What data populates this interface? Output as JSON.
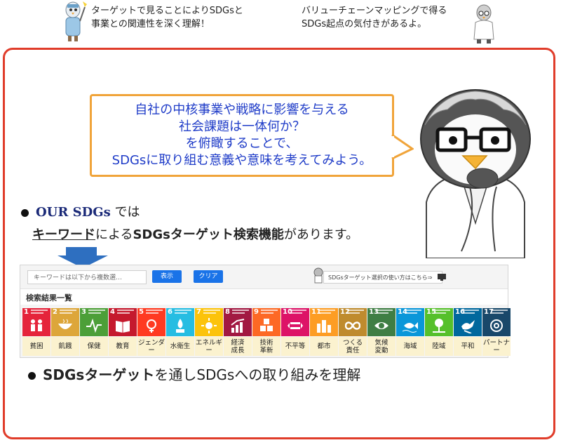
{
  "top_captions": {
    "left": [
      "ターゲットで見ることによりSDGsと",
      "事業との関連性を深く理解！"
    ],
    "right": [
      "バリューチェーンマッピングで得る",
      "SDGs起点の気付きがあるよ。"
    ]
  },
  "bubble": {
    "lines": [
      "自社の中核事業や戦略に影響を与える",
      "社会課題は一体何か？",
      "を俯瞰することで、",
      "SDGsに取り組む意義や意味を考えてみよう。"
    ]
  },
  "bullet1": {
    "brand": "OUR SDGs",
    "suffix": "では",
    "keyword": "キーワード",
    "middle": "による",
    "bold": "SDGsターゲット検索機能",
    "end": "があります。"
  },
  "bullet2": {
    "bold": "SDGsターゲット",
    "rest": "を通しSDGsへの取り組みを理解"
  },
  "app": {
    "search_placeholder": "キーワードは以下から複数選…",
    "show_button": "表示",
    "clear_button": "クリア",
    "help_text": "SDGsターゲット選択の使い方はこちら⇒",
    "results_title": "検索結果一覧",
    "goals": [
      {
        "num": "1",
        "label": "貧困",
        "color": "#e5243b",
        "icon": "people-icon"
      },
      {
        "num": "2",
        "label": "飢餓",
        "color": "#dda63a",
        "icon": "bowl-icon"
      },
      {
        "num": "3",
        "label": "保健",
        "color": "#4c9f38",
        "icon": "heartbeat-icon"
      },
      {
        "num": "4",
        "label": "教育",
        "color": "#c5192d",
        "icon": "book-icon"
      },
      {
        "num": "5",
        "label": "ジェンダー",
        "color": "#ff3a21",
        "icon": "gender-icon"
      },
      {
        "num": "6",
        "label": "水衛生",
        "color": "#26bde2",
        "icon": "water-icon"
      },
      {
        "num": "7",
        "label": "エネルギー",
        "color": "#fcc30b",
        "icon": "sun-icon"
      },
      {
        "num": "8",
        "label": "経済\n成長",
        "color": "#a21942",
        "icon": "growth-chart-icon"
      },
      {
        "num": "9",
        "label": "技術\n革新",
        "color": "#fd6925",
        "icon": "cubes-icon"
      },
      {
        "num": "10",
        "label": "不平等",
        "color": "#dd1367",
        "icon": "equality-icon"
      },
      {
        "num": "11",
        "label": "都市",
        "color": "#fd9d24",
        "icon": "city-icon"
      },
      {
        "num": "12",
        "label": "つくる\n責任",
        "color": "#bf8b2e",
        "icon": "infinity-icon"
      },
      {
        "num": "13",
        "label": "気候\n変動",
        "color": "#3f7e44",
        "icon": "eye-icon"
      },
      {
        "num": "14",
        "label": "海域",
        "color": "#0a97d9",
        "icon": "fish-icon"
      },
      {
        "num": "15",
        "label": "陸域",
        "color": "#56c02b",
        "icon": "tree-icon"
      },
      {
        "num": "16",
        "label": "平和",
        "color": "#00689d",
        "icon": "dove-icon"
      },
      {
        "num": "17",
        "label": "パートナー",
        "color": "#19486a",
        "icon": "flower-icon"
      }
    ]
  }
}
